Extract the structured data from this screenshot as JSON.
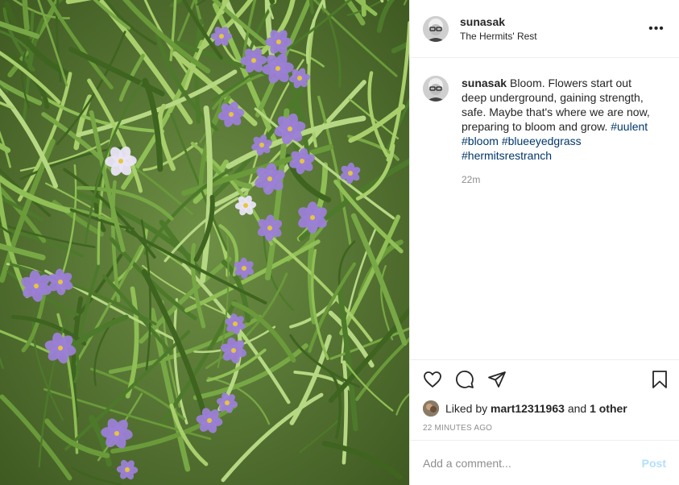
{
  "post": {
    "username": "sunasak",
    "location": "The Hermits' Rest",
    "more_glyph": "•••",
    "caption": {
      "username": "sunasak",
      "text": "Bloom. Flowers start out deep underground, gaining strength, safe. Maybe that's where we are now, preparing to bloom and grow.",
      "hashtags": [
        "#uulent",
        "#bloom",
        "#blueeyedgrass",
        "#hermitsrestranch"
      ],
      "time": "22m"
    },
    "icons": {
      "like": "heart-icon",
      "comment": "comment-icon",
      "share": "share-icon",
      "save": "bookmark-icon",
      "more": "more-options-icon"
    },
    "likes": {
      "prefix": "Liked by",
      "user": "mart12311963",
      "conjunction": "and",
      "others": "1 other"
    },
    "posted_ago": "22 MINUTES AGO",
    "comment_box": {
      "placeholder": "Add a comment...",
      "post_label": "Post"
    },
    "colors": {
      "hashtag": "#00376b",
      "post_button_disabled": "#b2dffc",
      "flower": "#9b7fd6"
    }
  }
}
